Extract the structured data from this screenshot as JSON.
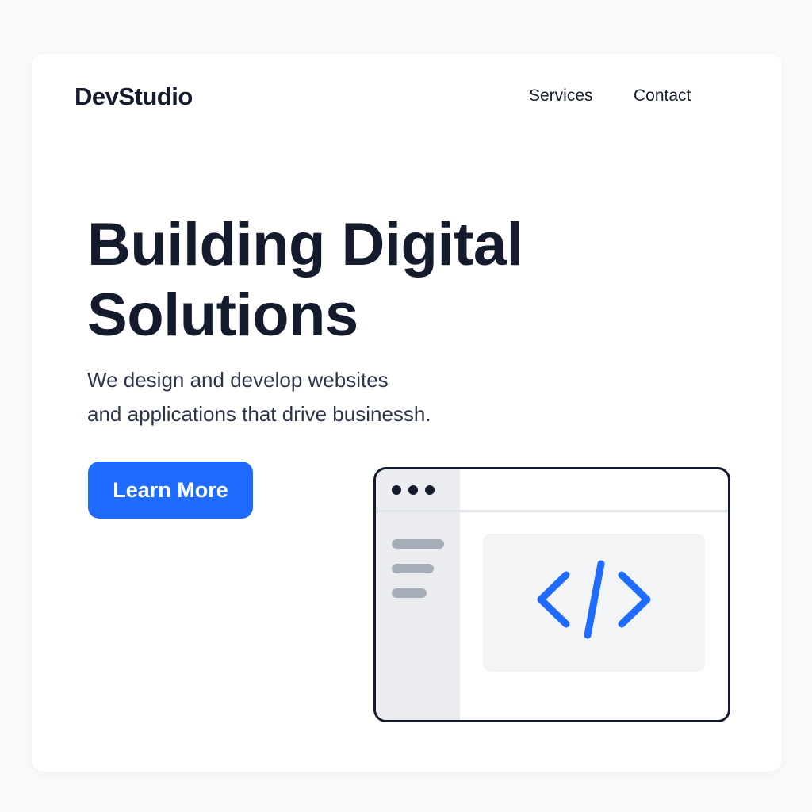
{
  "header": {
    "brand": "DevStudio",
    "nav": [
      {
        "label": "Services"
      },
      {
        "label": "Contact"
      }
    ]
  },
  "hero": {
    "title_line1": "Building Digital",
    "title_line2": "Solutions",
    "subtitle_line1": "We design and develop websites",
    "subtitle_line2": "and applications that drive businessh.",
    "cta_label": "Learn More"
  },
  "illustration": {
    "window_dots": 3,
    "sidebar_lines": 3,
    "icon": "code-brackets-icon"
  },
  "colors": {
    "accent": "#1f6bff",
    "text_dark": "#131b2c",
    "text_body": "#2d3648",
    "background": "#f8f9fa",
    "card": "#ffffff",
    "sidebar": "#eaecef",
    "panel": "#f3f4f6"
  }
}
